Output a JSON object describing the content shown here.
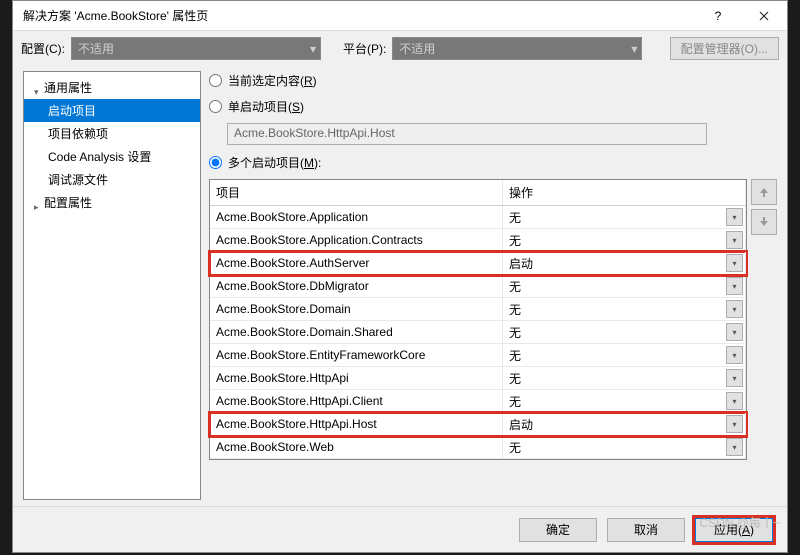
{
  "titlebar": {
    "title": "解决方案 'Acme.BookStore' 属性页"
  },
  "topbar": {
    "config_label": "配置(C):",
    "config_value": "不适用",
    "platform_label": "平台(P):",
    "platform_value": "不适用",
    "manager_btn": "配置管理器(O)..."
  },
  "tree": {
    "group_common": "通用属性",
    "item_startup": "启动项目",
    "item_deps": "项目依赖项",
    "item_code": "Code Analysis 设置",
    "item_debug": "调试源文件",
    "group_config": "配置属性"
  },
  "radios": {
    "current": "当前选定内容(R)",
    "single": "单启动项目(S)",
    "single_value": "Acme.BookStore.HttpApi.Host",
    "multi": "多个启动项目(M):"
  },
  "grid": {
    "col_project": "项目",
    "col_action": "操作",
    "rows": [
      {
        "project": "Acme.BookStore.Application",
        "action": "无",
        "hl": false
      },
      {
        "project": "Acme.BookStore.Application.Contracts",
        "action": "无",
        "hl": false
      },
      {
        "project": "Acme.BookStore.AuthServer",
        "action": "启动",
        "hl": true
      },
      {
        "project": "Acme.BookStore.DbMigrator",
        "action": "无",
        "hl": false
      },
      {
        "project": "Acme.BookStore.Domain",
        "action": "无",
        "hl": false
      },
      {
        "project": "Acme.BookStore.Domain.Shared",
        "action": "无",
        "hl": false
      },
      {
        "project": "Acme.BookStore.EntityFrameworkCore",
        "action": "无",
        "hl": false
      },
      {
        "project": "Acme.BookStore.HttpApi",
        "action": "无",
        "hl": false
      },
      {
        "project": "Acme.BookStore.HttpApi.Client",
        "action": "无",
        "hl": false
      },
      {
        "project": "Acme.BookStore.HttpApi.Host",
        "action": "启动",
        "hl": true
      },
      {
        "project": "Acme.BookStore.Web",
        "action": "无",
        "hl": false
      }
    ]
  },
  "footer": {
    "ok": "确定",
    "cancel": "取消",
    "apply": "应用(A)"
  },
  "watermark": "CSDN @每丨~"
}
